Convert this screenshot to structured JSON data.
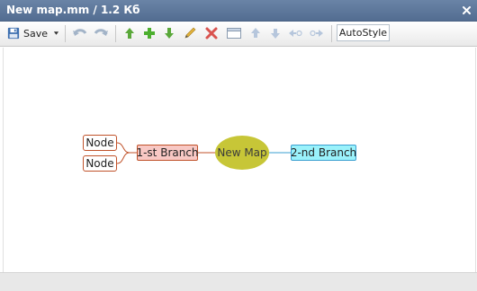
{
  "window": {
    "title": "New map.mm / 1.2 Кб"
  },
  "toolbar": {
    "save_label": "Save",
    "autostyle_label": "AutoStyle"
  },
  "map": {
    "root": "New Map",
    "branch1": {
      "label": "1-st Branch",
      "children": [
        "Node",
        "Node"
      ]
    },
    "branch2": {
      "label": "2-nd Branch"
    }
  },
  "colors": {
    "root_fill": "#c7c637",
    "branch1_fill": "#f8c8c4",
    "branch1_line": "#c0522a",
    "branch2_fill": "#9af2fb",
    "branch2_line": "#3a9fd0"
  }
}
